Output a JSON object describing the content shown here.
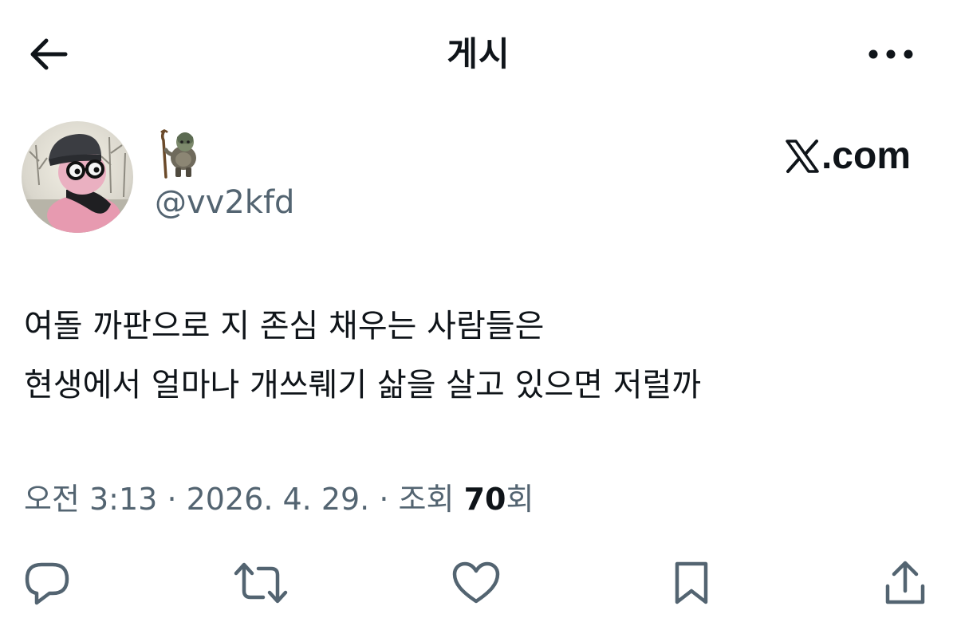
{
  "header": {
    "title": "게시",
    "back_icon": "arrow-left-icon",
    "more_icon": "more-horizontal-icon"
  },
  "author": {
    "avatar_icon": "profile-avatar",
    "display_name_icon": "troll-figure-emoji",
    "handle": "@vv2kfd"
  },
  "brand": {
    "icon": "x-logo-icon",
    "suffix": ".com"
  },
  "post": {
    "lines": [
      "여돌 까판으로 지 존심 채우는 사람들은",
      "현생에서 얼마나 개쓰뤠기 삶을 살고 있으면 저럴까"
    ]
  },
  "meta": {
    "time": "오전 3:13",
    "separator": "·",
    "date": "2026. 4. 29.",
    "views_prefix": "조회",
    "views_count": "70",
    "views_suffix": "회"
  },
  "actions": {
    "reply_icon": "reply-icon",
    "repost_icon": "repost-icon",
    "like_icon": "heart-icon",
    "bookmark_icon": "bookmark-icon",
    "share_icon": "share-icon"
  },
  "colors": {
    "text_primary": "#0f1419",
    "text_secondary": "#536471",
    "background": "#ffffff"
  }
}
